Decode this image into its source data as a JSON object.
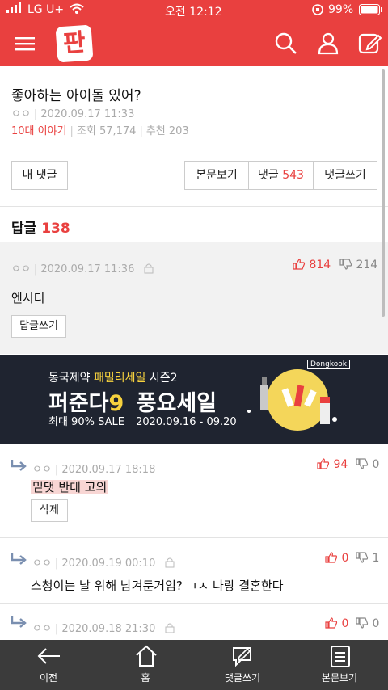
{
  "status": {
    "carrier": "LG U+",
    "time": "오전 12:12",
    "battery": "99%"
  },
  "header": {
    "logo": "판"
  },
  "post": {
    "title": "좋아하는 아이돌 있어?",
    "author": "ㅇㅇ",
    "date": "2020.09.17 11:33",
    "category": "10대 이야기",
    "views": "조회 57,174",
    "likes": "추천 203"
  },
  "actions": {
    "my_comments": "내 댓글",
    "view_post": "본문보기",
    "comments_label": "댓글",
    "comments_count": "543",
    "write_comment": "댓글쓰기"
  },
  "replies_header": {
    "label": "답글",
    "count": "138"
  },
  "comments": [
    {
      "author": "ㅇㅇ",
      "date": "2020.09.17 11:36",
      "text": "엔시티",
      "up": "814",
      "down": "214",
      "button": "답글쓰기"
    },
    {
      "author": "ㅇㅇ",
      "date": "2020.09.17 18:18",
      "text": "밑댓 반대 고의",
      "up": "94",
      "down": "0",
      "button": "삭제"
    },
    {
      "author": "ㅇㅇ",
      "date": "2020.09.19 00:10",
      "text": "스청이는 날 위해 남겨둔거임? ㄱㅅ 나랑 결혼한다",
      "up": "0",
      "down": "1"
    },
    {
      "author": "ㅇㅇ",
      "date": "2020.09.18 21:30",
      "up": "0",
      "down": "0"
    }
  ],
  "ad": {
    "line1_a": "동국제약",
    "line1_b": "패밀리세일",
    "line1_c": "시즌2",
    "line2_a": "퍼준다",
    "line2_b": "9",
    "line2_c": "풍요세일",
    "line3_a": "최대 90% SALE",
    "line3_b": "2020.09.16 - 09.20",
    "brand": "Dongkook"
  },
  "bottom_nav": [
    {
      "label": "이전"
    },
    {
      "label": "홈"
    },
    {
      "label": "댓글쓰기"
    },
    {
      "label": "본문보기"
    }
  ],
  "colors": {
    "accent": "#e9403f",
    "bottom_bar": "#3b3b3b",
    "ad_bg": "#1f2430",
    "ad_yellow": "#f7d23e"
  }
}
